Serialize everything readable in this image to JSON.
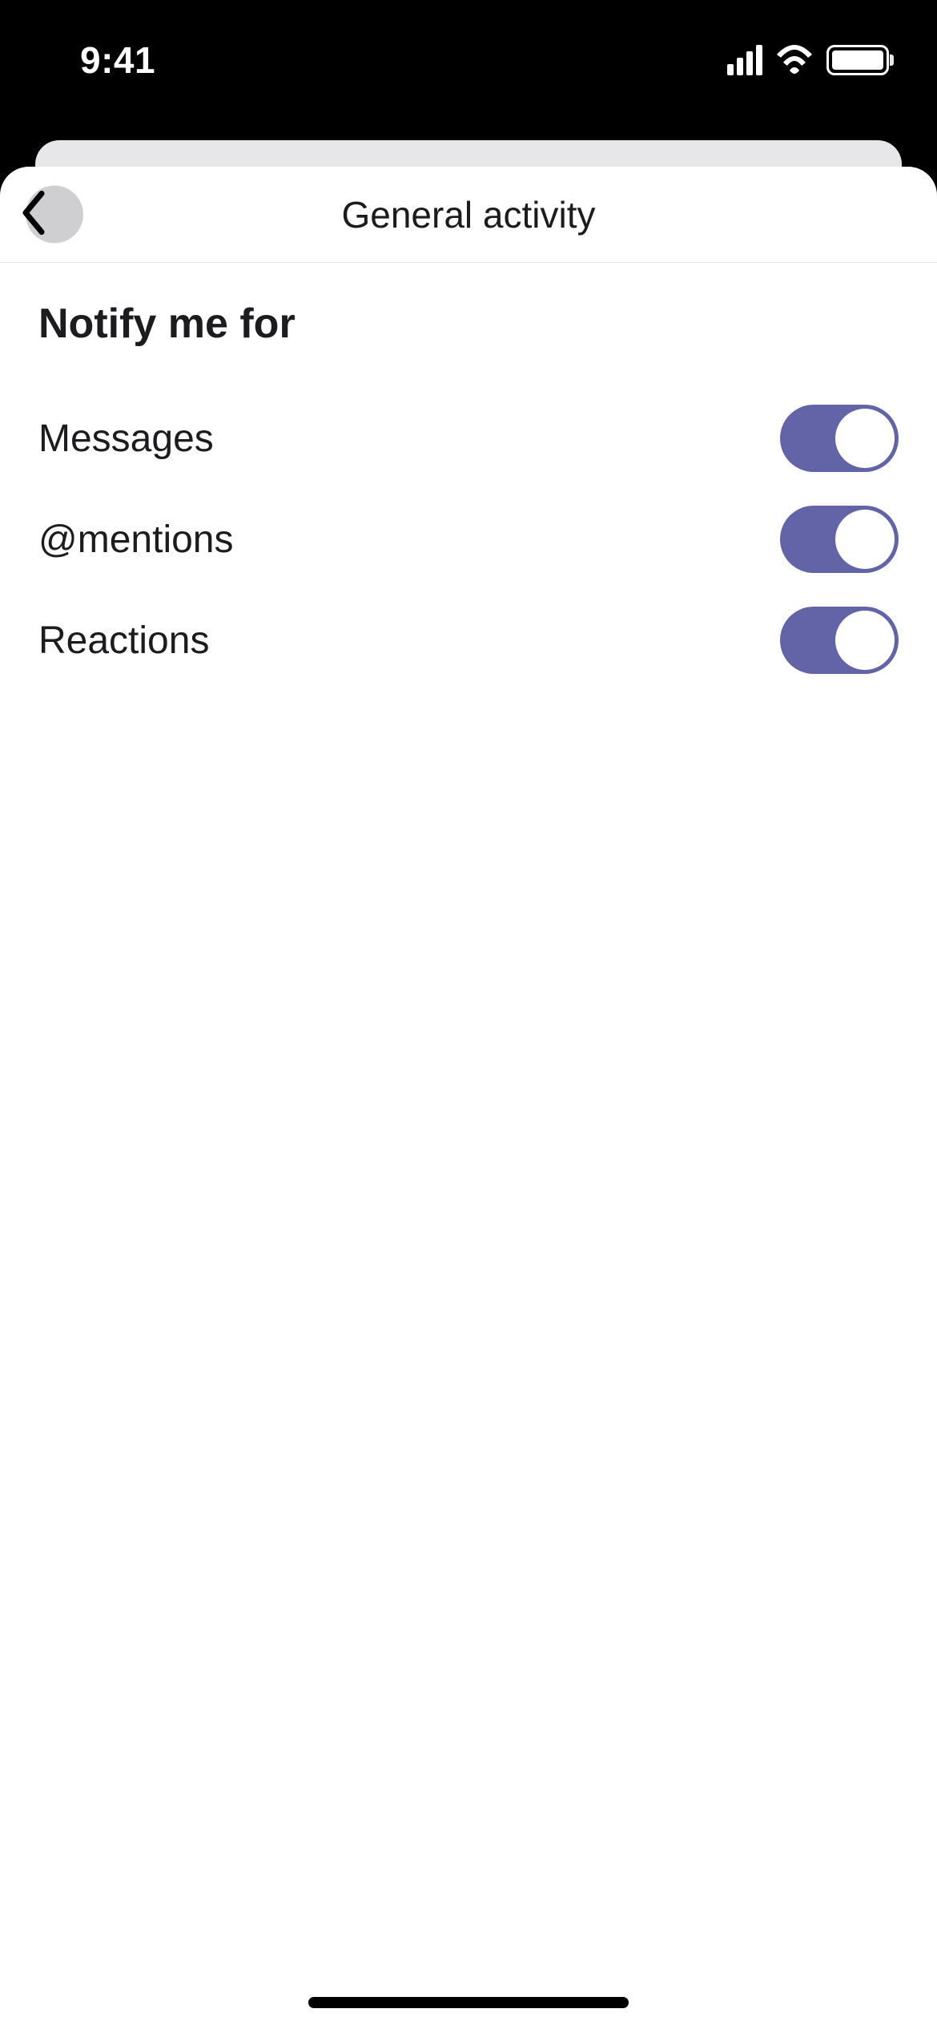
{
  "status": {
    "time": "9:41"
  },
  "header": {
    "title": "General activity"
  },
  "section": {
    "title": "Notify me for"
  },
  "rows": [
    {
      "label": "Messages",
      "enabled": true
    },
    {
      "label": "@mentions",
      "enabled": true
    },
    {
      "label": "Reactions",
      "enabled": true
    }
  ]
}
